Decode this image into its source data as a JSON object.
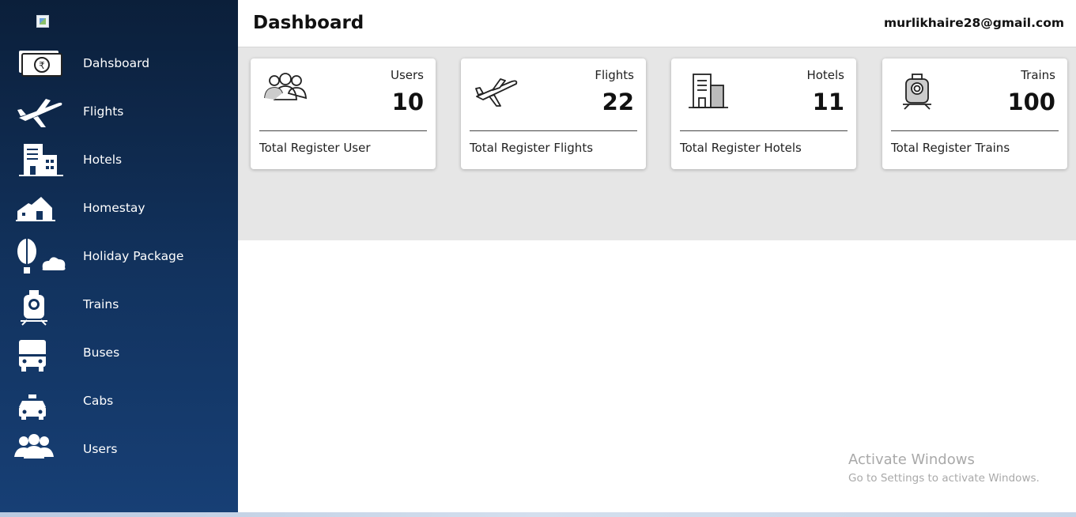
{
  "sidebar": {
    "items": [
      {
        "label": "Dahsboard",
        "icon": "rupee-note-icon"
      },
      {
        "label": "Flights",
        "icon": "airplane-icon"
      },
      {
        "label": "Hotels",
        "icon": "building-icon"
      },
      {
        "label": "Homestay",
        "icon": "house-icon"
      },
      {
        "label": "Holiday Package",
        "icon": "hot-air-balloon-icon"
      },
      {
        "label": "Trains",
        "icon": "train-icon"
      },
      {
        "label": "Buses",
        "icon": "bus-icon"
      },
      {
        "label": "Cabs",
        "icon": "taxi-icon"
      },
      {
        "label": "Users",
        "icon": "users-icon"
      }
    ]
  },
  "header": {
    "title": "Dashboard",
    "email": "murlikhaire28@gmail.com"
  },
  "cards": [
    {
      "title": "Users",
      "value": "10",
      "footer": "Total Register User",
      "icon": "users-icon"
    },
    {
      "title": "Flights",
      "value": "22",
      "footer": "Total Register Flights",
      "icon": "airplane-icon"
    },
    {
      "title": "Hotels",
      "value": "11",
      "footer": "Total Register Hotels",
      "icon": "building-icon"
    },
    {
      "title": "Trains",
      "value": "100",
      "footer": "Total Register Trains",
      "icon": "train-icon"
    }
  ],
  "watermark": {
    "title": "Activate Windows",
    "subtitle": "Go to Settings to activate Windows."
  },
  "colors": {
    "sidebar_top": "#0b1f3a",
    "sidebar_bottom": "#173f75",
    "content_band": "#e6e6e6"
  }
}
